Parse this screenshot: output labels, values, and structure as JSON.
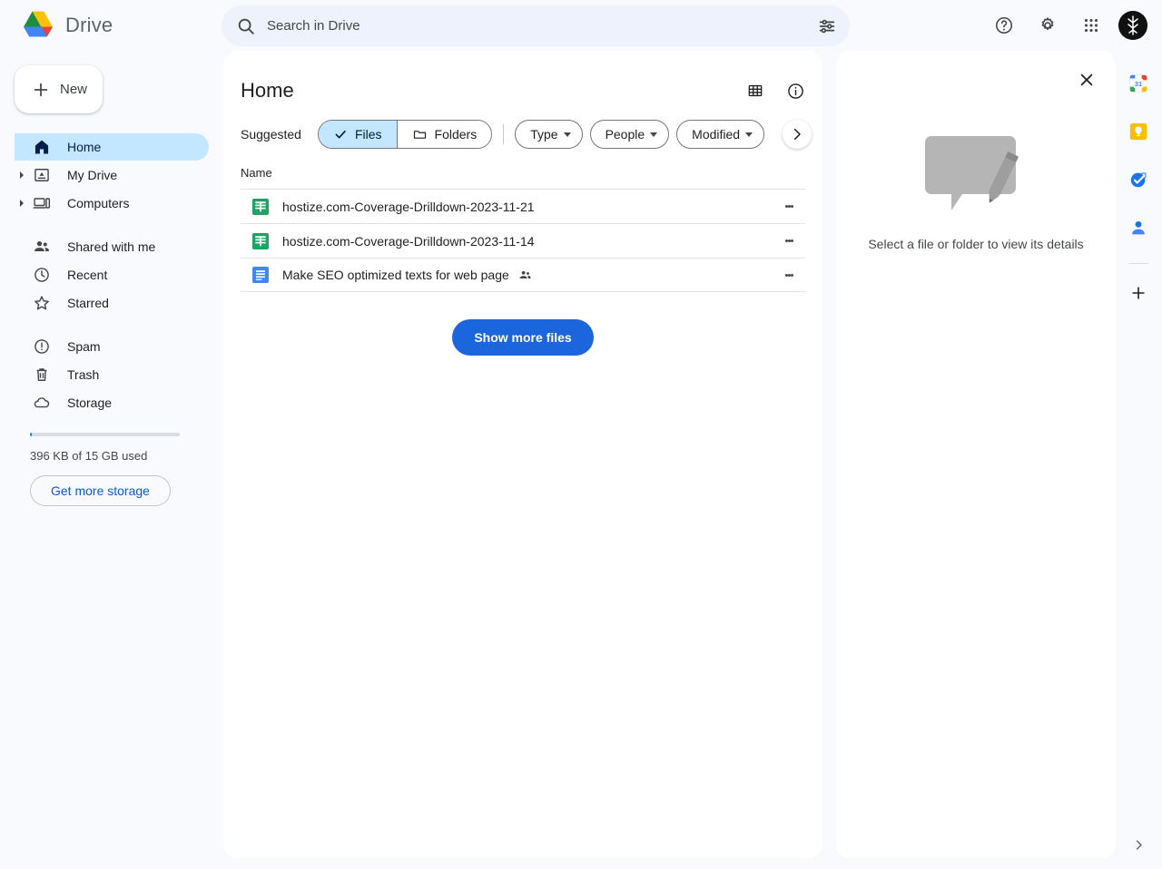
{
  "app": {
    "brand_name": "Drive",
    "logo_icon": "drive-logo"
  },
  "search": {
    "placeholder": "Search in Drive",
    "value": "",
    "search_icon": "search-icon",
    "filter_icon": "tune-icon"
  },
  "top_actions": {
    "help_icon": "help-circle-icon",
    "settings_icon": "gear-icon",
    "apps_icon": "apps-grid-icon",
    "avatar_icon": "account-avatar"
  },
  "sidebar": {
    "new_button": {
      "label": "New",
      "icon": "plus-icon"
    },
    "items": [
      {
        "label": "Home",
        "icon": "home-icon",
        "active": true,
        "expandable": false
      },
      {
        "label": "My Drive",
        "icon": "my-drive-icon",
        "active": false,
        "expandable": true
      },
      {
        "label": "Computers",
        "icon": "computers-icon",
        "active": false,
        "expandable": true
      },
      {
        "label": "Shared with me",
        "icon": "people-icon",
        "active": false,
        "expandable": false
      },
      {
        "label": "Recent",
        "icon": "clock-icon",
        "active": false,
        "expandable": false
      },
      {
        "label": "Starred",
        "icon": "star-icon",
        "active": false,
        "expandable": false
      },
      {
        "label": "Spam",
        "icon": "spam-icon",
        "active": false,
        "expandable": false
      },
      {
        "label": "Trash",
        "icon": "trash-icon",
        "active": false,
        "expandable": false
      },
      {
        "label": "Storage",
        "icon": "cloud-icon",
        "active": false,
        "expandable": false
      }
    ],
    "storage": {
      "usage_text": "396 KB of 15 GB used",
      "used_percent": 1,
      "button_label": "Get more storage"
    }
  },
  "main": {
    "title": "Home",
    "grid_view_icon": "grid-view-icon",
    "info_icon": "info-circle-icon",
    "filters": {
      "suggested_label": "Suggested",
      "segmented": [
        {
          "label": "Files",
          "icon": "check-icon",
          "selected": true
        },
        {
          "label": "Folders",
          "icon": "folder-icon",
          "selected": false
        }
      ],
      "chips": [
        {
          "label": "Type"
        },
        {
          "label": "People"
        },
        {
          "label": "Modified"
        }
      ],
      "scroll_next_icon": "chevron-right-icon"
    },
    "list": {
      "column_name": "Name",
      "rows": [
        {
          "name": "hostize.com-Coverage-Drilldown-2023-11-21",
          "icon": "google-sheets-icon",
          "shared": false,
          "more_icon": "more-vert-icon"
        },
        {
          "name": "hostize.com-Coverage-Drilldown-2023-11-14",
          "icon": "google-sheets-icon",
          "shared": false,
          "more_icon": "more-vert-icon"
        },
        {
          "name": "Make SEO optimized texts for web page",
          "icon": "google-docs-icon",
          "shared": true,
          "more_icon": "more-vert-icon"
        }
      ]
    },
    "show_more_label": "Show more files"
  },
  "details": {
    "close_icon": "close-icon",
    "empty_illustration": "comment-pencil-illustration",
    "empty_text": "Select a file or folder to view its details"
  },
  "rail": {
    "items": [
      {
        "icon": "google-calendar-icon"
      },
      {
        "icon": "google-keep-icon"
      },
      {
        "icon": "google-tasks-icon"
      },
      {
        "icon": "google-contacts-icon"
      }
    ],
    "add_icon": "plus-icon",
    "expand_icon": "chevron-right-icon"
  },
  "colors": {
    "accent_blue": "#1b66dc",
    "active_chip": "#c2e7ff",
    "page_bg": "#f8fafd",
    "sheets_green": "#1ea362",
    "docs_blue": "#4285f4",
    "link_blue": "#0b57d0"
  }
}
